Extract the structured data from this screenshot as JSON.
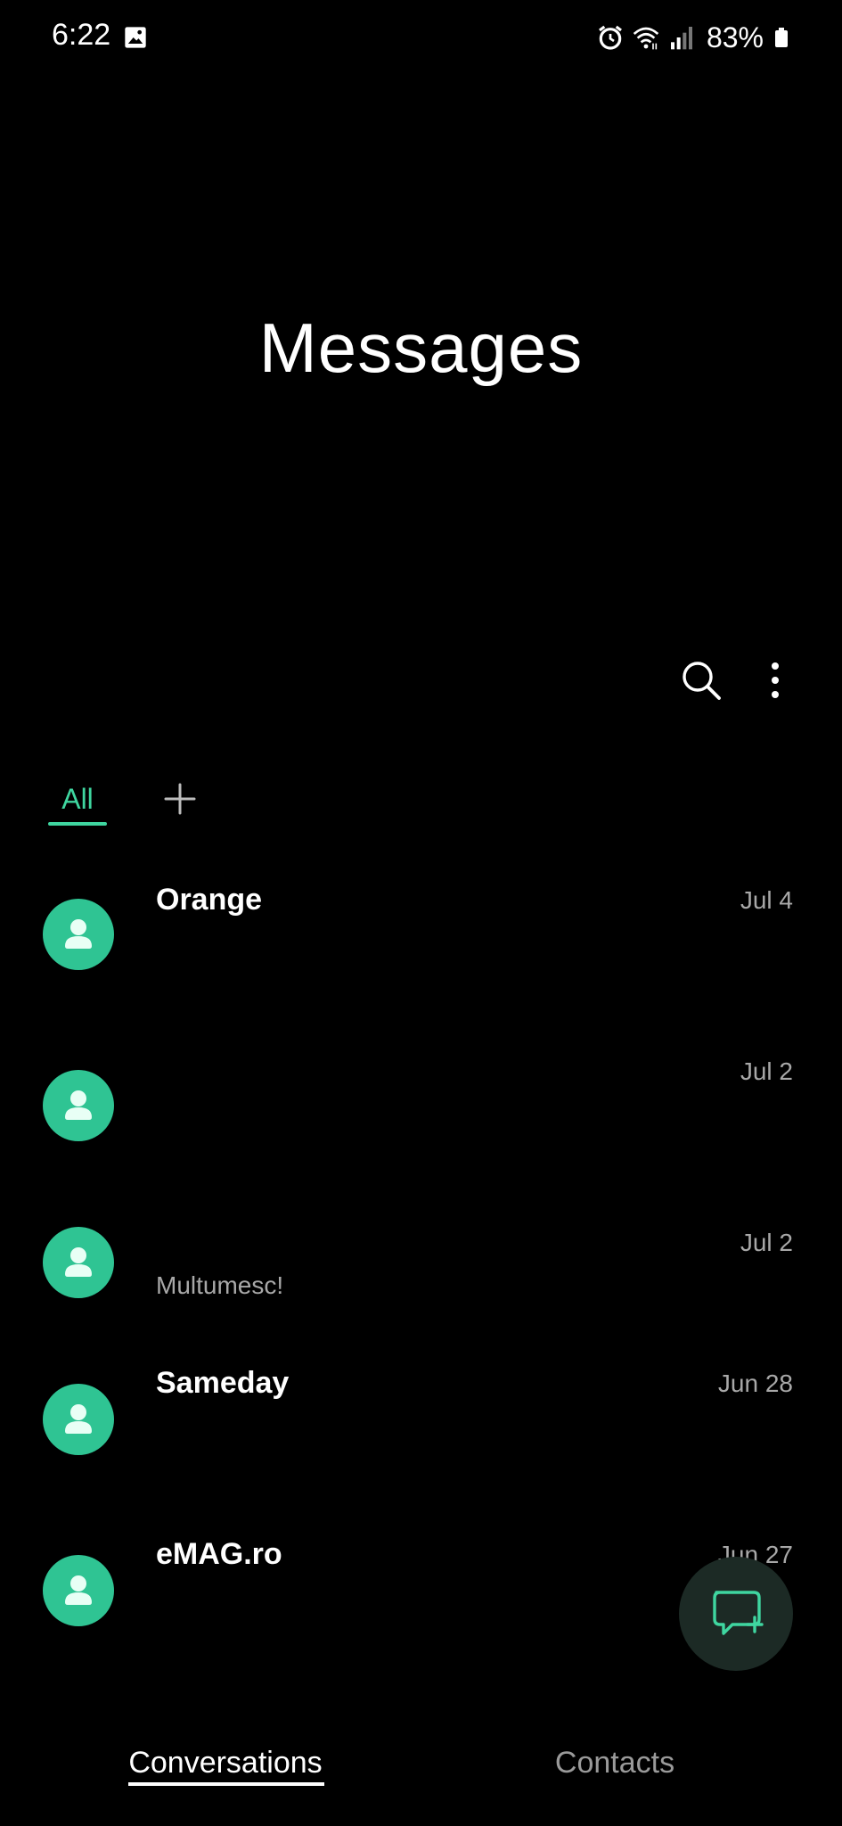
{
  "status_bar": {
    "time": "6:22",
    "battery": "83%",
    "left_icon": "image-notification-icon",
    "right_icons": [
      "alarm-icon",
      "wifi-icon",
      "signal-icon",
      "battery-icon"
    ]
  },
  "header": {
    "title": "Messages"
  },
  "toolbar": {
    "search_icon": "search-icon",
    "more_icon": "more-vert-icon"
  },
  "filter_tabs": {
    "all_label": "All",
    "add_icon": "plus-icon"
  },
  "conversations": [
    {
      "name": "Orange",
      "date": "Jul 4",
      "preview": ""
    },
    {
      "name": "",
      "date": "Jul 2",
      "preview": ""
    },
    {
      "name": "",
      "date": "Jul 2",
      "preview": "Multumesc!"
    },
    {
      "name": "Sameday",
      "date": "Jun 28",
      "preview": ""
    },
    {
      "name": "eMAG.ro",
      "date": "Jun 27",
      "preview": ""
    }
  ],
  "fab": {
    "icon": "new-message-icon"
  },
  "bottom_nav": {
    "conversations_label": "Conversations",
    "contacts_label": "Contacts"
  },
  "colors": {
    "background": "#000000",
    "accent": "#3fd6a0",
    "avatar": "#2fc493",
    "secondary_text": "#a8a8a8"
  }
}
